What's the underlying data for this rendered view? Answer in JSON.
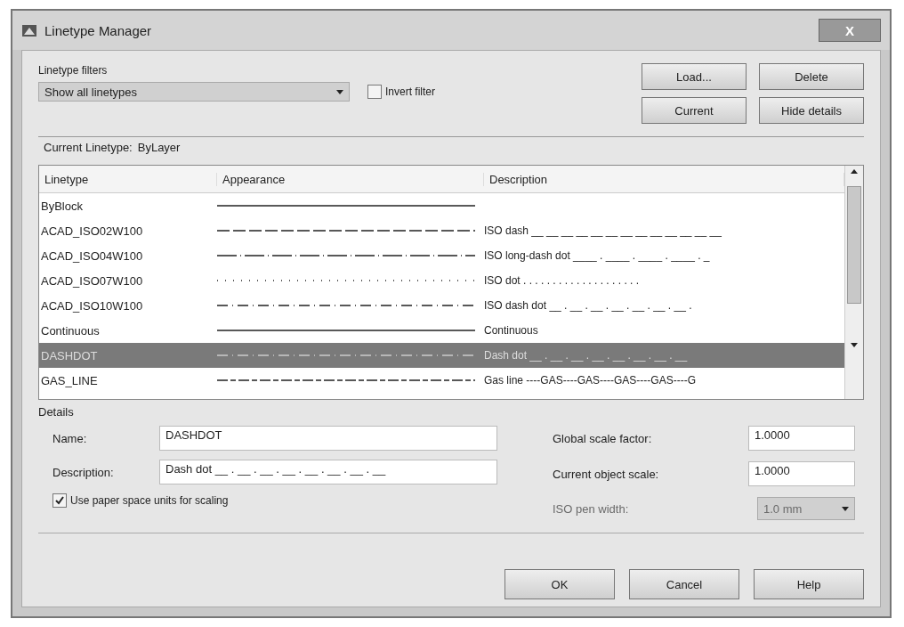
{
  "window": {
    "title": "Linetype Manager",
    "close_label": "X"
  },
  "filter": {
    "label": "Linetype filters",
    "value": "Show all linetypes",
    "invert": {
      "label": "Invert filter",
      "checked": false
    }
  },
  "top_buttons": [
    {
      "label": "Load..."
    },
    {
      "label": "Delete"
    },
    {
      "label": "Current"
    },
    {
      "label": "Hide details"
    }
  ],
  "current_linetype": {
    "label": "Current Linetype:",
    "value": "ByLayer"
  },
  "table": {
    "columns": [
      "Linetype",
      "Appearance",
      "Description"
    ],
    "rows": [
      {
        "name": "ByBlock",
        "kind": "solid",
        "description": "",
        "selected": false
      },
      {
        "name": "ACAD_ISO02W100",
        "kind": "dash",
        "description": "ISO dash __ __ __ __ __ __ __ __ __ __ __ __ __",
        "selected": false
      },
      {
        "name": "ACAD_ISO04W100",
        "kind": "longdashdot",
        "description": "ISO long-dash dot ____ . ____ . ____ . ____ . _",
        "selected": false
      },
      {
        "name": "ACAD_ISO07W100",
        "kind": "dot",
        "description": "ISO dot . . . . . . . . . . . . . . . . . . . .",
        "selected": false
      },
      {
        "name": "ACAD_ISO10W100",
        "kind": "dashdot",
        "description": "ISO dash dot __ . __ . __ . __ . __ . __ . __ .",
        "selected": false
      },
      {
        "name": "Continuous",
        "kind": "solid",
        "description": "Continuous",
        "selected": false
      },
      {
        "name": "DASHDOT",
        "kind": "dashdot",
        "description": "Dash dot __ . __ . __ . __ . __ . __ . __ . __",
        "selected": true
      },
      {
        "name": "GAS_LINE",
        "kind": "gas",
        "description": "Gas line ----GAS----GAS----GAS----GAS----G",
        "selected": false
      }
    ]
  },
  "details": {
    "title": "Details",
    "name_label": "Name:",
    "name_value": "DASHDOT",
    "description_label": "Description:",
    "description_value": "Dash dot __ . __ . __ . __ . __ . __ . __ . __",
    "paper_space": {
      "label": "Use paper space units for scaling",
      "checked": true
    },
    "global_scale": {
      "label": "Global scale factor:",
      "value": "1.0000"
    },
    "object_scale": {
      "label": "Current object scale:",
      "value": "1.0000"
    },
    "pen_width": {
      "label": "ISO pen width:",
      "value": "1.0 mm",
      "disabled": true
    }
  },
  "bottom_buttons": [
    {
      "label": "OK"
    },
    {
      "label": "Cancel"
    },
    {
      "label": "Help"
    }
  ]
}
